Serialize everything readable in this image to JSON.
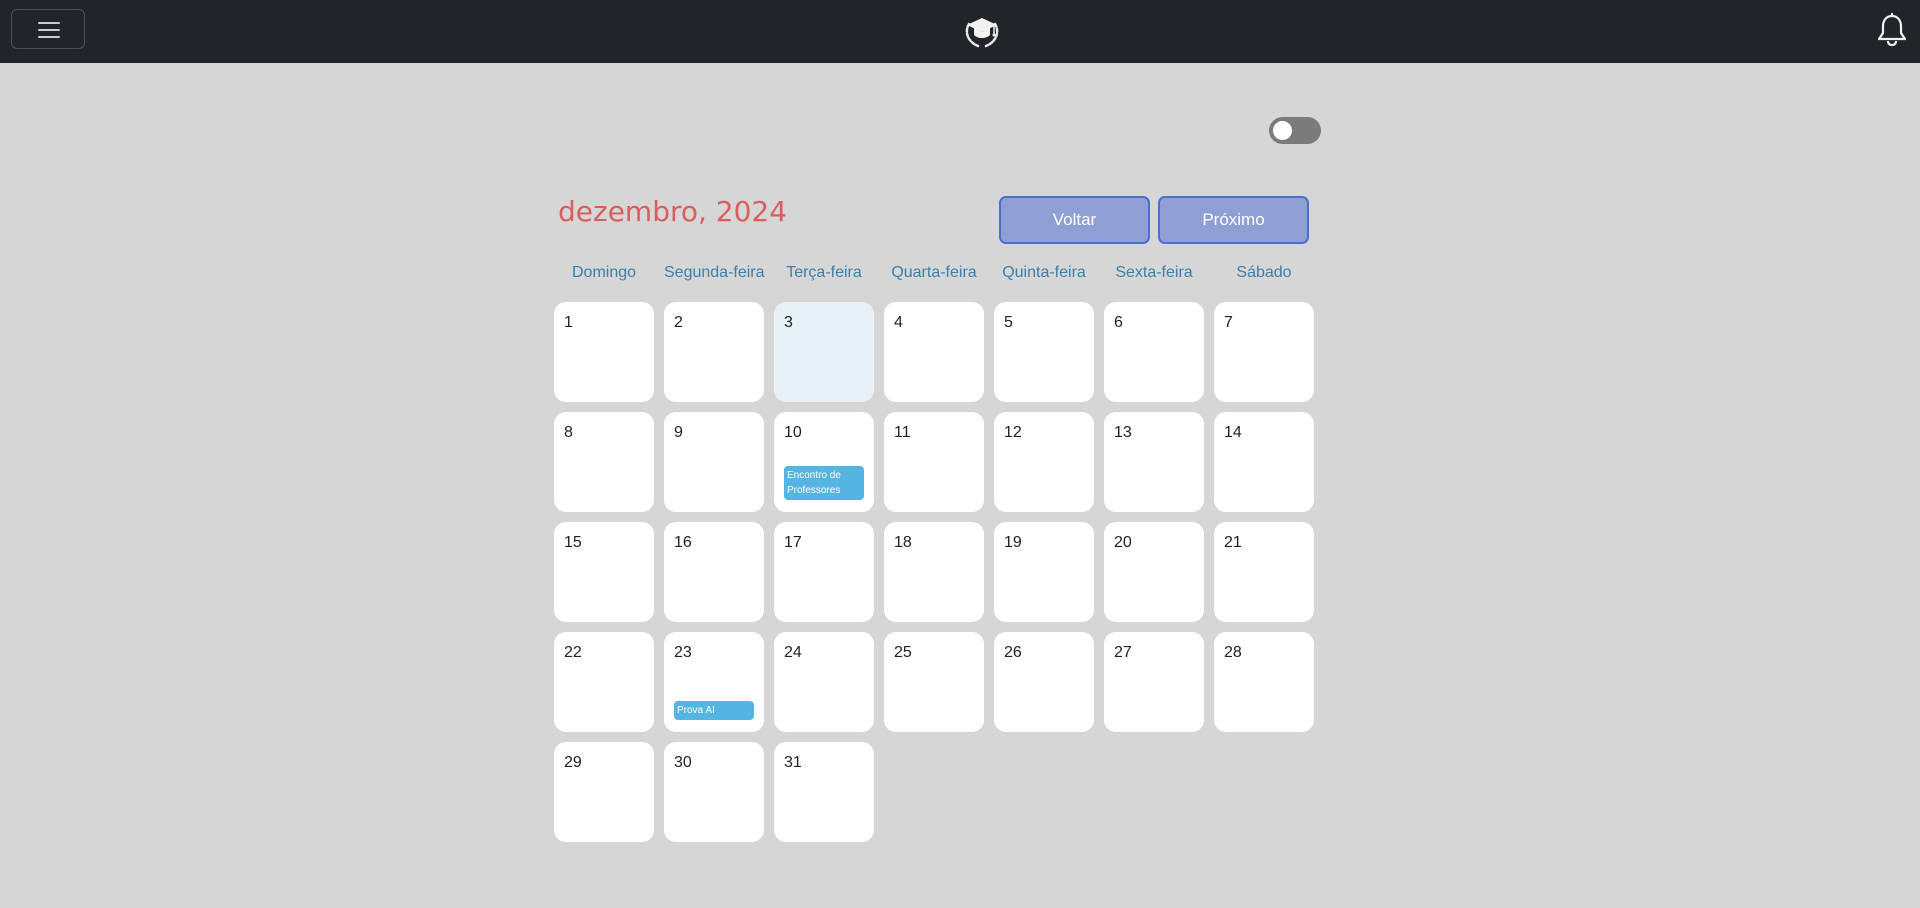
{
  "navbar": {
    "menu_icon": "hamburger-menu-icon",
    "logo_icon": "graduation-cap-laurel-icon",
    "bell_icon": "bell-icon"
  },
  "theme_toggle": {
    "checked": false
  },
  "calendar": {
    "title": "dezembro, 2024",
    "prev_label": "Voltar",
    "next_label": "Próximo",
    "weekdays": [
      "Domingo",
      "Segunda-feira",
      "Terça-feira",
      "Quarta-feira",
      "Quinta-feira",
      "Sexta-feira",
      "Sábado"
    ],
    "days": [
      "1",
      "2",
      "3",
      "4",
      "5",
      "6",
      "7",
      "8",
      "9",
      "10",
      "11",
      "12",
      "13",
      "14",
      "15",
      "16",
      "17",
      "18",
      "19",
      "20",
      "21",
      "22",
      "23",
      "24",
      "25",
      "26",
      "27",
      "28",
      "29",
      "30",
      "31"
    ],
    "today": "3",
    "events": [
      {
        "day": "10",
        "title": "Encontro de Professores"
      },
      {
        "day": "23",
        "title": "Prova AI"
      }
    ]
  },
  "colors": {
    "navbar": "#212529",
    "background": "#d6d6d6",
    "title": "#d95f5f",
    "weekday": "#3c7fa8",
    "button": "#8f9fd6",
    "event": "#55b5e2",
    "today": "#e6f1f8"
  }
}
